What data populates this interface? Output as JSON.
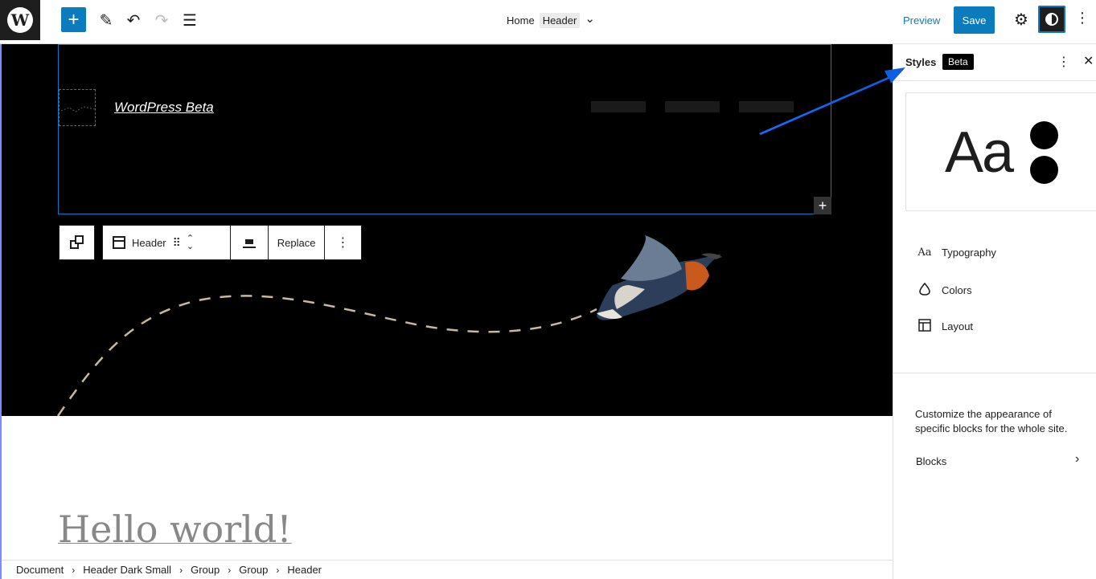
{
  "topbar": {
    "logo_glyph": "W",
    "add_glyph": "+",
    "edit_glyph": "✎",
    "undo_glyph": "↶",
    "redo_glyph": "↷",
    "list_glyph": "☰",
    "doc_title": "Home",
    "doc_badge": "Header",
    "doc_chevron": "⌄",
    "preview_label": "Preview",
    "save_label": "Save",
    "settings_glyph": "⚙",
    "more_glyph": "⋮"
  },
  "canvas": {
    "site_title": "WordPress Beta",
    "inserter_glyph": "+",
    "hello_text": "Hello world!"
  },
  "block_toolbar": {
    "block_name": "Header",
    "drag_glyph": "⠿",
    "move_up_glyph": "⌃",
    "move_down_glyph": "⌄",
    "replace_label": "Replace",
    "options_glyph": "⋮"
  },
  "breadcrumb": {
    "items": [
      "Document",
      "Header Dark Small",
      "Group",
      "Group",
      "Header"
    ],
    "separator": "›"
  },
  "sidebar": {
    "title": "Styles",
    "badge": "Beta",
    "kebab_glyph": "⋮",
    "close_glyph": "✕",
    "preview_text": "Aa",
    "items": [
      {
        "label": "Typography",
        "icon_glyph": "Aa"
      },
      {
        "label": "Colors",
        "icon_glyph": "💧"
      },
      {
        "label": "Layout",
        "icon_glyph": "▦"
      }
    ],
    "description": "Customize the appearance of specific blocks for the whole site.",
    "blocks_label": "Blocks",
    "blocks_chevron": "›"
  },
  "colors": {
    "accent": "#0a7cbe",
    "annotation_arrow": "#1a73ff",
    "canvas_dark": "#000000"
  }
}
